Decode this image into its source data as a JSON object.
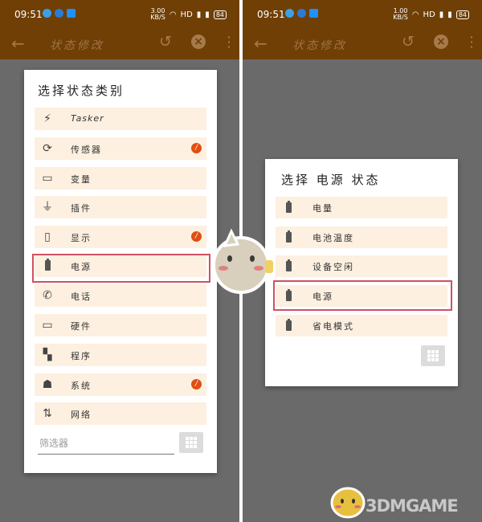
{
  "status_bar": {
    "left_time": "09:51",
    "right_time": "09:51",
    "left_speed": "3.00",
    "right_speed": "1.00",
    "speed_unit": "KB/S",
    "network": "HD",
    "battery": "84"
  },
  "app_bar": {
    "title": "状态修改"
  },
  "left_dialog": {
    "title": "选择状态类别",
    "items": [
      {
        "label": "Tasker",
        "icon": "lightning-icon",
        "badge": false
      },
      {
        "label": "传感器",
        "icon": "rotate-screen-icon",
        "badge": true
      },
      {
        "label": "变量",
        "icon": "tag-icon",
        "badge": false
      },
      {
        "label": "插件",
        "icon": "plug-icon",
        "badge": false
      },
      {
        "label": "显示",
        "icon": "phone-icon",
        "badge": true
      },
      {
        "label": "电源",
        "icon": "battery-icon",
        "badge": false
      },
      {
        "label": "电话",
        "icon": "phone-call-icon",
        "badge": false
      },
      {
        "label": "硬件",
        "icon": "laptop-icon",
        "badge": false
      },
      {
        "label": "程序",
        "icon": "apps-icon",
        "badge": false
      },
      {
        "label": "系统",
        "icon": "android-icon",
        "badge": true
      },
      {
        "label": "网络",
        "icon": "data-arrows-icon",
        "badge": false
      }
    ],
    "filter_placeholder": "筛选器"
  },
  "right_dialog": {
    "title": "选择 电源 状态",
    "items": [
      {
        "label": "电量",
        "icon": "battery-icon"
      },
      {
        "label": "电池温度",
        "icon": "battery-icon"
      },
      {
        "label": "设备空闲",
        "icon": "battery-icon"
      },
      {
        "label": "电源",
        "icon": "battery-icon"
      },
      {
        "label": "省电模式",
        "icon": "battery-icon"
      }
    ]
  },
  "badge_glyph": "/",
  "watermark": "3DMGAME",
  "colors": {
    "app_bar": "#6f3f05",
    "row_background": "#fdf0e0",
    "highlight": "#d05060",
    "badge": "#e04e12",
    "overlay": "#6a6a6a"
  }
}
